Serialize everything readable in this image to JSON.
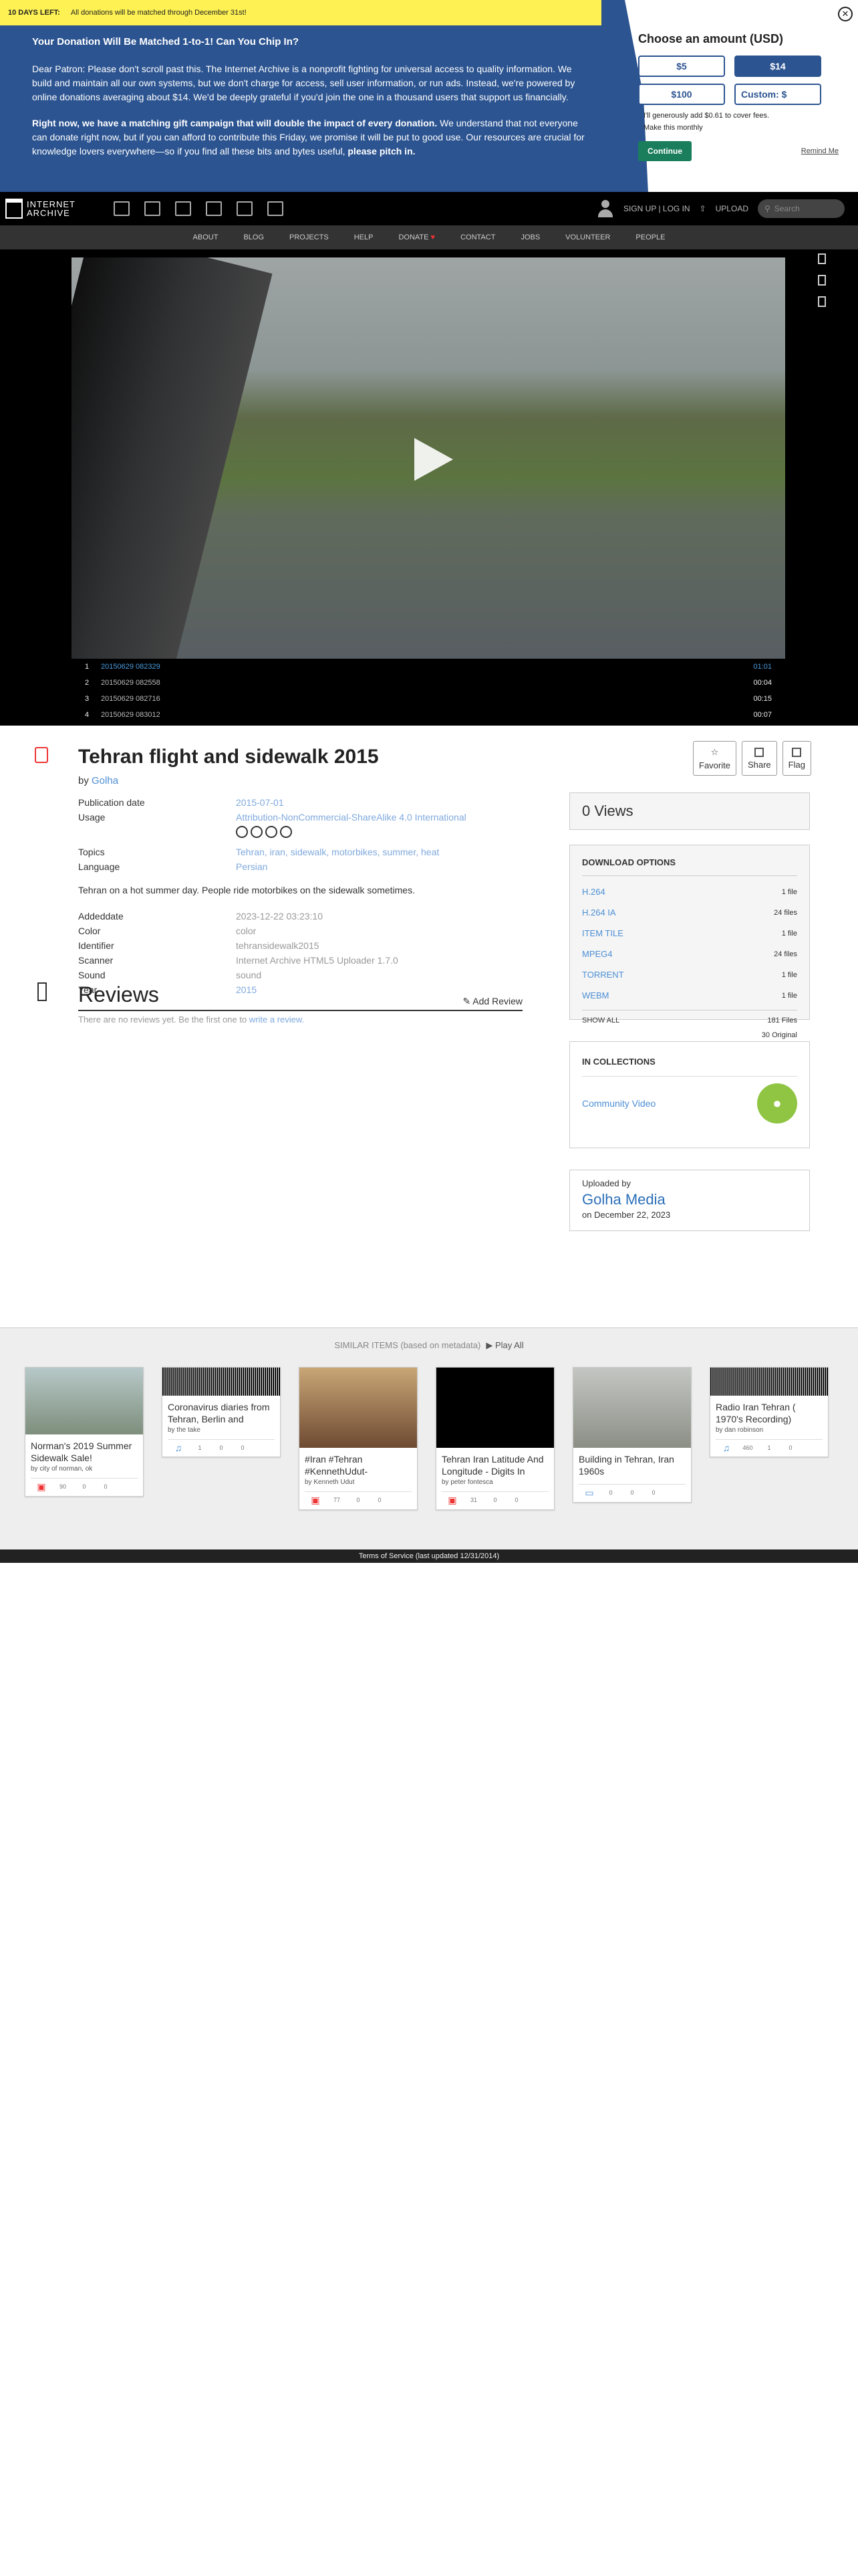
{
  "banner": {
    "ticker_bold": "10 DAYS LEFT:",
    "ticker_text": "All donations will be matched through December 31st!",
    "heading": "Your Donation Will Be Matched 1-to-1! Can You Chip In?",
    "paragraph1": "Dear Patron: Please don't scroll past this. The Internet Archive is a nonprofit fighting for universal access to quality information. We build and maintain all our own systems, but we don't charge for access, sell user information, or run ads. Instead, we're powered by online donations averaging about $14. We'd be deeply grateful if you'd join the one in a thousand users that support us financially.",
    "paragraph2_bold": "Right now, we have a matching gift campaign that will double the impact of every donation.",
    "paragraph2": " We understand that not everyone can donate right now, but if you can afford to contribute this Friday, we promise it will be put to good use. Our resources are crucial for knowledge lovers everywhere—so if you find all these bits and bytes useful,",
    "paragraph2_end": " please pitch in.",
    "panel_title": "Choose an amount (USD)",
    "amounts": [
      "$5",
      "$14",
      "$100",
      "Custom: $"
    ],
    "selected_amount": "$14",
    "checkbox1": "I'll generously add $0.61 to cover fees.",
    "checkbox2": "Make this monthly",
    "continue_label": "Continue",
    "remind_label": "Remind Me",
    "close_glyph": "✕"
  },
  "nav": {
    "logo_line1": "INTERNET",
    "logo_line2": "ARCHIVE",
    "signup": "SIGN UP | LOG IN",
    "upload": "UPLOAD",
    "search_placeholder": "Search",
    "menu": [
      "ABOUT",
      "BLOG",
      "PROJECTS",
      "HELP",
      "DONATE",
      "CONTACT",
      "JOBS",
      "VOLUNTEER",
      "PEOPLE"
    ]
  },
  "player": {
    "playlist": [
      {
        "n": "1",
        "title": "20150629 082329",
        "dur": "01:01",
        "active": true
      },
      {
        "n": "2",
        "title": "20150629 082558",
        "dur": "00:04",
        "active": false
      },
      {
        "n": "3",
        "title": "20150629 082716",
        "dur": "00:15",
        "active": false
      },
      {
        "n": "4",
        "title": "20150629 083012",
        "dur": "00:07",
        "active": false
      }
    ]
  },
  "item": {
    "title": "Tehran flight and sidewalk 2015",
    "by_label": "by",
    "creator": "Golha",
    "actions": [
      "Favorite",
      "Share",
      "Flag"
    ],
    "publication_date_label": "Publication date",
    "publication_date": "2015-07-01",
    "usage_label": "Usage",
    "usage": "Attribution-NonCommercial-ShareAlike 4.0 International",
    "topics_label": "Topics",
    "topics": "Tehran, iran, sidewalk, motorbikes, summer, heat",
    "language_label": "Language",
    "language": "Persian",
    "description": "Tehran on a hot summer day. People ride motorbikes on the sidewalk sometimes.",
    "addeddate_label": "Addeddate",
    "addeddate": "2023-12-22 03:23:10",
    "color_label": "Color",
    "color": "color",
    "identifier_label": "Identifier",
    "identifier": "tehransidewalk2015",
    "scanner_label": "Scanner",
    "scanner": "Internet Archive HTML5 Uploader 1.7.0",
    "sound_label": "Sound",
    "sound": "sound",
    "year_label": "Year",
    "year": "2015"
  },
  "reviews": {
    "title": "Reviews",
    "add_label": "Add Review",
    "empty_text": "There are no reviews yet. Be the first one to ",
    "empty_link": "write a review."
  },
  "sidebar": {
    "views": "0 Views",
    "download_title": "DOWNLOAD OPTIONS",
    "downloads": [
      {
        "format": "H.264",
        "count": "1 file"
      },
      {
        "format": "H.264 IA",
        "count": "24 files"
      },
      {
        "format": "ITEM TILE",
        "count": "1 file"
      },
      {
        "format": "MPEG4",
        "count": "24 files"
      },
      {
        "format": "TORRENT",
        "count": "1 file"
      },
      {
        "format": "WEBM",
        "count": "1 file"
      }
    ],
    "show_all": "SHOW ALL",
    "total_files": "181 Files",
    "original_files": "30 Original",
    "collections_title": "IN COLLECTIONS",
    "collection": "Community Video",
    "uploaded_by_label": "Uploaded by",
    "uploader": "Golha Media",
    "uploaded_on": "on December 22, 2023"
  },
  "similar": {
    "header": "SIMILAR ITEMS (based on metadata)",
    "play_all": "Play All",
    "cards": [
      {
        "title": "Norman's 2019 Summer Sidewalk Sale!",
        "by": "by city of norman, ok",
        "stats": [
          "90",
          "0",
          "0"
        ],
        "type": "movie"
      },
      {
        "title": "Coronavirus diaries from Tehran, Berlin and",
        "by": "by the take",
        "stats": [
          "1",
          "0",
          "0"
        ],
        "type": "audio"
      },
      {
        "title": "#Iran #Tehran #KennethUdut-",
        "by": "by Kenneth Udut",
        "stats": [
          "77",
          "0",
          "0"
        ],
        "type": "movie"
      },
      {
        "title": "Tehran Iran Latitude And Longitude - Digits In",
        "by": "by peter fontesca",
        "stats": [
          "31",
          "0",
          "0"
        ],
        "type": "movie"
      },
      {
        "title": "Building in Tehran, Iran 1960s",
        "by": "",
        "stats": [
          "0",
          "0",
          "0"
        ],
        "type": "image"
      },
      {
        "title": "Radio Iran Tehran ( 1970's Recording)",
        "by": "by dan robinson",
        "stats": [
          "460",
          "1",
          "0"
        ],
        "type": "audio"
      }
    ]
  },
  "footer": {
    "text": "Terms of Service (last updated 12/31/2014)"
  }
}
